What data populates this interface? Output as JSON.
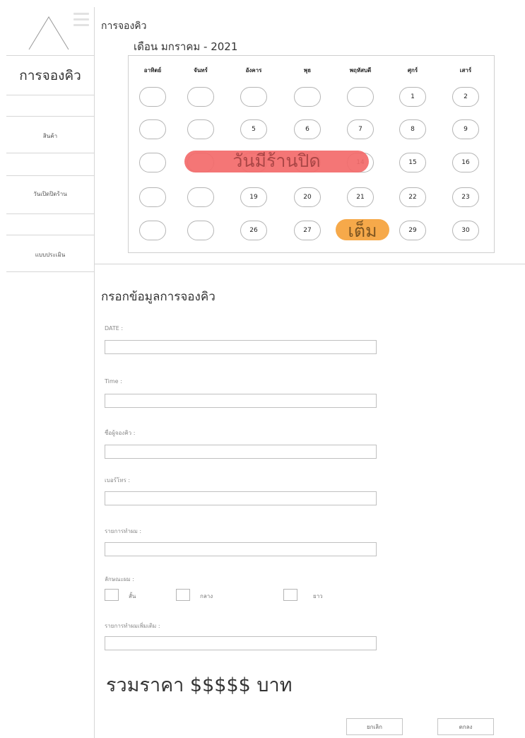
{
  "sidebar": {
    "title": "การจองคิว",
    "items": [
      {
        "label": "สินค้า"
      },
      {
        "label": "วันเปิดปิดร้าน"
      },
      {
        "label": "แบบประเมิน"
      }
    ]
  },
  "header": {
    "title": "การจองคิว",
    "month": "เดือน มกราคม - 2021"
  },
  "calendar": {
    "days_of_week": [
      "อาทิตย์",
      "จันทร์",
      "อังคาร",
      "พุธ",
      "พฤหัสบดี",
      "ศุกร์",
      "เสาร์"
    ],
    "weeks": [
      [
        "",
        "",
        "",
        "",
        "",
        "1",
        "2"
      ],
      [
        "",
        "",
        "5",
        "6",
        "7",
        "8",
        "9"
      ],
      [
        "",
        "",
        "",
        "",
        "14",
        "15",
        "16"
      ],
      [
        "",
        "",
        "19",
        "20",
        "21",
        "22",
        "23"
      ],
      [
        "",
        "",
        "26",
        "27",
        "",
        "29",
        "30"
      ]
    ],
    "closed_label": "วันมีร้านปิด",
    "full_label": "เต็ม",
    "colors": {
      "closed": "#f36a6a",
      "full": "#f6a94a"
    }
  },
  "form": {
    "title": "กรอกข้อมูลการจองคิว",
    "date_label": "DATE :",
    "time_label": "Time :",
    "name_label": "ชื่อผู้จองคิว :",
    "phone_label": "เบอร์โทร :",
    "service_label": "รายการทำผม :",
    "hair_length_label": "ลักษณะผม :",
    "hair_options": [
      "สั้น",
      "กลาง",
      "ยาว"
    ],
    "extra_service_label": "รายการทำผมเพิ่มเติม :",
    "total": "รวมราคา $$$$$ บาท",
    "cancel_label": "ยกเลิก",
    "confirm_label": "ตกลง"
  }
}
